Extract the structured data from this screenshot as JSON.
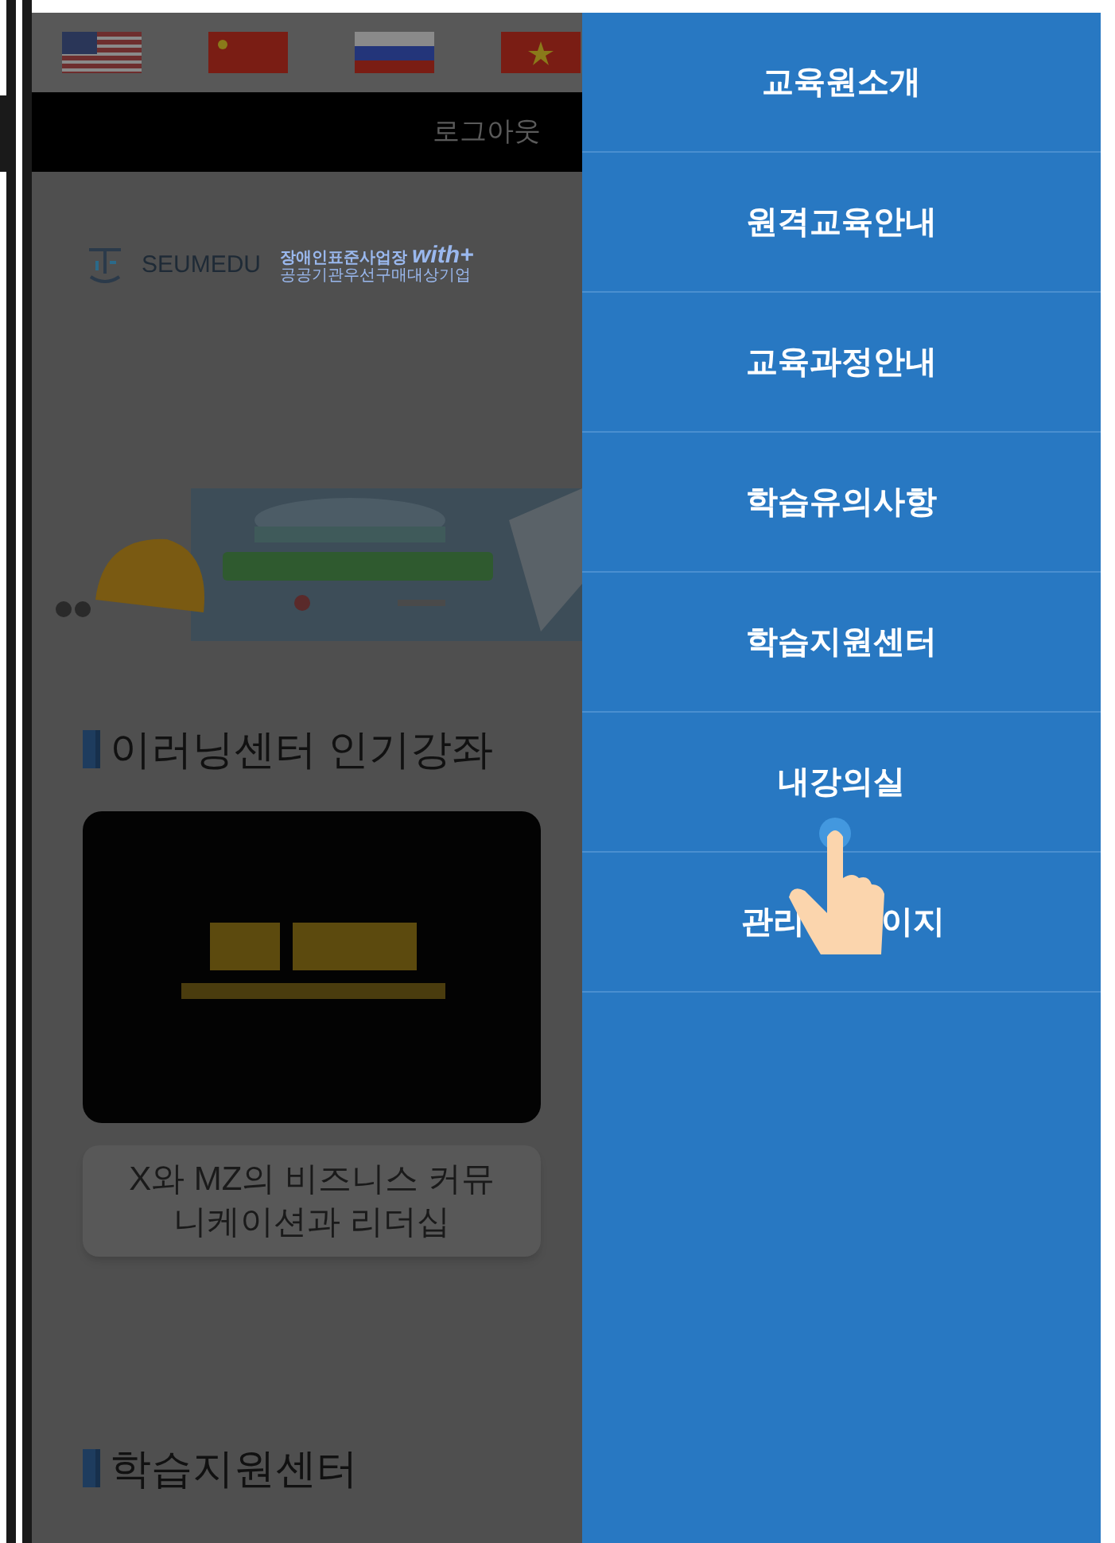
{
  "language_flags": [
    {
      "kind": "us"
    },
    {
      "kind": "cn"
    },
    {
      "kind": "ru"
    },
    {
      "kind": "vn"
    }
  ],
  "top_bar": {
    "logout": "로그아웃"
  },
  "logo": {
    "name": "SEUMEDU",
    "badge_title": "장애인표준사업장",
    "badge_mark": "with+",
    "badge_subtitle": "공공기관우선구매대상기업"
  },
  "popular_section": {
    "title": "이러닝센터 인기강좌",
    "courses": [
      {
        "title": "X와 MZ의 비즈니스 커뮤니케이션과 리더십"
      }
    ]
  },
  "support_section": {
    "title": "학습지원센터"
  },
  "side_menu": {
    "items": [
      {
        "label": "교육원소개"
      },
      {
        "label": "원격교육안내"
      },
      {
        "label": "교육과정안내"
      },
      {
        "label": "학습유의사항"
      },
      {
        "label": "학습지원센터"
      },
      {
        "label": "내강의실"
      },
      {
        "label_parts": [
          "관리",
          "이지"
        ]
      }
    ]
  }
}
